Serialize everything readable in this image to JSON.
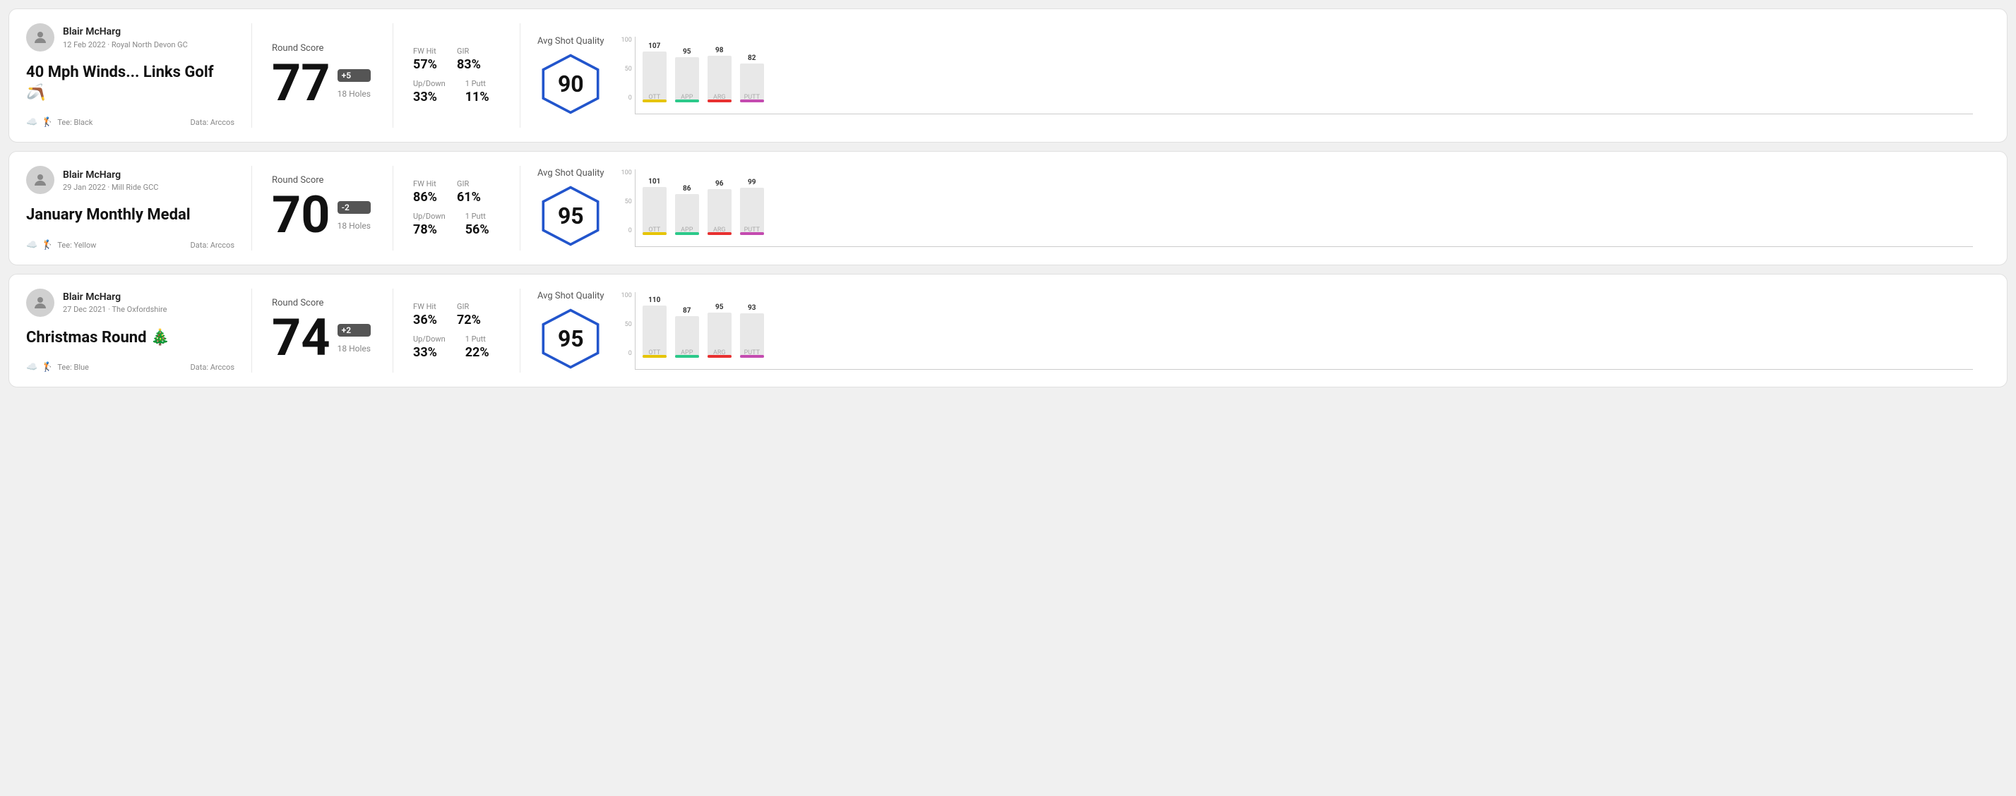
{
  "rounds": [
    {
      "id": "round1",
      "user": {
        "name": "Blair McHarg",
        "date": "12 Feb 2022 · Royal North Devon GC"
      },
      "title": "40 Mph Winds... Links Golf 🪃",
      "tee": "Black",
      "data_source": "Arccos",
      "score": {
        "label": "Round Score",
        "value": "77",
        "badge": "+5",
        "badge_type": "positive",
        "holes": "18 Holes"
      },
      "stats": {
        "fw_hit_label": "FW Hit",
        "fw_hit_value": "57%",
        "gir_label": "GIR",
        "gir_value": "83%",
        "updown_label": "Up/Down",
        "updown_value": "33%",
        "oneputt_label": "1 Putt",
        "oneputt_value": "11%"
      },
      "quality": {
        "label": "Avg Shot Quality",
        "value": "90",
        "bars": [
          {
            "label": "OTT",
            "value": 107,
            "height_pct": 72,
            "color": "#e6c400"
          },
          {
            "label": "APP",
            "value": 95,
            "height_pct": 64,
            "color": "#2cc98a"
          },
          {
            "label": "ARG",
            "value": 98,
            "height_pct": 66,
            "color": "#e83030"
          },
          {
            "label": "PUTT",
            "value": 82,
            "height_pct": 55,
            "color": "#c44bb0"
          }
        ]
      }
    },
    {
      "id": "round2",
      "user": {
        "name": "Blair McHarg",
        "date": "29 Jan 2022 · Mill Ride GCC"
      },
      "title": "January Monthly Medal",
      "tee": "Yellow",
      "data_source": "Arccos",
      "score": {
        "label": "Round Score",
        "value": "70",
        "badge": "-2",
        "badge_type": "negative",
        "holes": "18 Holes"
      },
      "stats": {
        "fw_hit_label": "FW Hit",
        "fw_hit_value": "86%",
        "gir_label": "GIR",
        "gir_value": "61%",
        "updown_label": "Up/Down",
        "updown_value": "78%",
        "oneputt_label": "1 Putt",
        "oneputt_value": "56%"
      },
      "quality": {
        "label": "Avg Shot Quality",
        "value": "95",
        "bars": [
          {
            "label": "OTT",
            "value": 101,
            "height_pct": 68,
            "color": "#e6c400"
          },
          {
            "label": "APP",
            "value": 86,
            "height_pct": 58,
            "color": "#2cc98a"
          },
          {
            "label": "ARG",
            "value": 96,
            "height_pct": 65,
            "color": "#e83030"
          },
          {
            "label": "PUTT",
            "value": 99,
            "height_pct": 67,
            "color": "#c44bb0"
          }
        ]
      }
    },
    {
      "id": "round3",
      "user": {
        "name": "Blair McHarg",
        "date": "27 Dec 2021 · The Oxfordshire"
      },
      "title": "Christmas Round 🎄",
      "tee": "Blue",
      "data_source": "Arccos",
      "score": {
        "label": "Round Score",
        "value": "74",
        "badge": "+2",
        "badge_type": "positive",
        "holes": "18 Holes"
      },
      "stats": {
        "fw_hit_label": "FW Hit",
        "fw_hit_value": "36%",
        "gir_label": "GIR",
        "gir_value": "72%",
        "updown_label": "Up/Down",
        "updown_value": "33%",
        "oneputt_label": "1 Putt",
        "oneputt_value": "22%"
      },
      "quality": {
        "label": "Avg Shot Quality",
        "value": "95",
        "bars": [
          {
            "label": "OTT",
            "value": 110,
            "height_pct": 74,
            "color": "#e6c400"
          },
          {
            "label": "APP",
            "value": 87,
            "height_pct": 59,
            "color": "#2cc98a"
          },
          {
            "label": "ARG",
            "value": 95,
            "height_pct": 64,
            "color": "#e83030"
          },
          {
            "label": "PUTT",
            "value": 93,
            "height_pct": 63,
            "color": "#c44bb0"
          }
        ]
      }
    }
  ],
  "y_axis_labels": [
    "100",
    "50",
    "0"
  ]
}
